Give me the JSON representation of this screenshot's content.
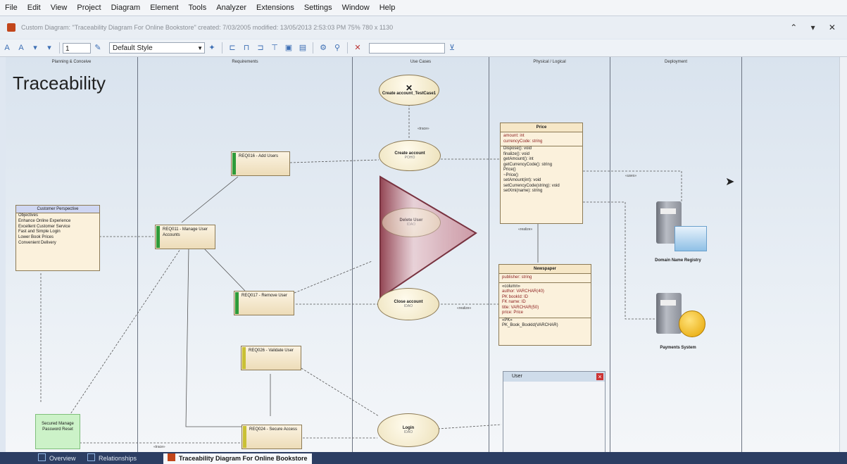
{
  "menu": [
    "File",
    "Edit",
    "View",
    "Project",
    "Diagram",
    "Element",
    "Tools",
    "Analyzer",
    "Extensions",
    "Settings",
    "Window",
    "Help"
  ],
  "titlebar": {
    "text": "Custom Diagram: \"Traceability Diagram For Online Bookstore\"   created: 7/03/2005  modified: 13/05/2013 2:53:03 PM   75%   780 x 1130",
    "controls": "⌃ ▾ ✕"
  },
  "toolbar": {
    "zoom_value": "1",
    "style_value": "Default Style"
  },
  "diagram": {
    "title": "Traceability",
    "lanes": [
      "Planning & Conceive",
      "Requirements",
      "Use Cases",
      "Physical / Logical",
      "Deployment"
    ],
    "requirements": [
      {
        "label": "REQ016 - Add Users"
      },
      {
        "label": "REQ011 - Manage User Accounts"
      },
      {
        "label": "REQ017 - Remove User"
      },
      {
        "label": "REQ026 - Validate User"
      },
      {
        "label": "REQ024 - Secure Access"
      }
    ],
    "use_cases": [
      {
        "title": "Create account_TestCase1",
        "sub": ""
      },
      {
        "title": "Create account",
        "sub": "POHO"
      },
      {
        "title": "Delete User",
        "sub": "IDAO"
      },
      {
        "title": "Close account",
        "sub": "IDAO"
      },
      {
        "title": "Login",
        "sub": "IDAO"
      }
    ],
    "perspective": {
      "title": "Customer Perspective",
      "rows": [
        "Objectives",
        "Enhance Online Experience",
        "Excellent Customer Service",
        "Fast and Simple Login",
        "Lower Book Prices",
        "Convenient Delivery"
      ]
    },
    "price_class": {
      "title": "Price",
      "attributes": [
        "amount: int",
        "currencyCode: string"
      ],
      "operations": [
        "Dispose(): void",
        "finalize(): void",
        "getAmount(): int",
        "getCurrencyCode(): string",
        "Price()",
        "~Price()",
        "setAmount(int): void",
        "setCurrencyCode(string): void",
        "setXmi(name): string"
      ]
    },
    "newspaper_class": {
      "title": "Newspaper",
      "attributes": [
        "publisher: string"
      ],
      "columns_header": "«column»",
      "columns": [
        "author: VARCHAR(40)",
        "PK bookId: ID",
        "FK name: ID",
        "title: VARCHAR(50)",
        "price: Price"
      ],
      "pk_header": "«PK»",
      "pk": [
        "PK_Book_Bookld(VARCHAR)"
      ]
    },
    "note_green": "Secured Manage Password Reset",
    "deploy": [
      "Domain Name Registry",
      "Payments System"
    ],
    "tags": {
      "trace": "«trace»",
      "realize": "«realize»",
      "uses": "«uses»"
    },
    "mini_window": {
      "title": "User"
    }
  },
  "tabs": [
    {
      "label": "Overview"
    },
    {
      "label": "Relationships"
    },
    {
      "label": "Traceability Diagram For Online Bookstore"
    }
  ],
  "colors": {
    "req_bar_green": "#2e9b3a",
    "req_bar_yellow": "#c9c035",
    "tabbar": "#2c3e63"
  }
}
